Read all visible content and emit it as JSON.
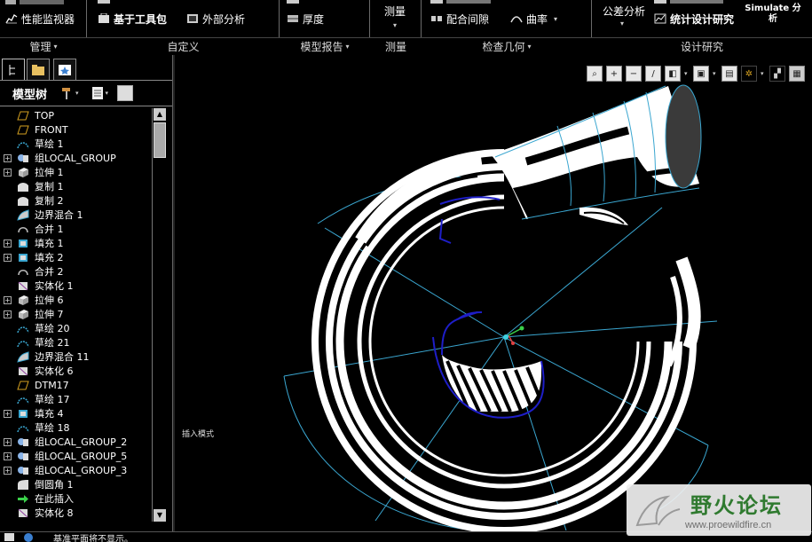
{
  "ribbon": {
    "groups": [
      {
        "label": "管理",
        "has_menu": true,
        "buttons": [
          {
            "label": "性能监视器",
            "icon": "performance-monitor-icon"
          }
        ]
      },
      {
        "label": "自定义",
        "has_menu": false,
        "buttons": [
          {
            "label": "基于工具包",
            "icon": "toolkit-icon"
          },
          {
            "label": "外部分析",
            "icon": "external-analysis-icon"
          }
        ]
      },
      {
        "label": "模型报告",
        "has_menu": true,
        "buttons": [
          {
            "label": "厚度",
            "icon": "thickness-icon"
          }
        ]
      },
      {
        "label": "测量",
        "has_menu": false,
        "buttons": [
          {
            "label": "测量",
            "icon": "measure-icon"
          }
        ]
      },
      {
        "label": "检查几何",
        "has_menu": true,
        "buttons": [
          {
            "label": "配合间隙",
            "icon": "clearance-icon"
          },
          {
            "label": "曲率",
            "icon": "curvature-icon"
          }
        ]
      },
      {
        "label": "设计研究",
        "has_menu": false,
        "buttons": [
          {
            "label": "公差分析",
            "icon": "tolerance-analysis-icon"
          },
          {
            "label": "统计设计研究",
            "icon": "statistical-design-icon"
          },
          {
            "label": "Simulate 分析",
            "icon": "simulate-icon"
          }
        ]
      }
    ]
  },
  "left_panel": {
    "tree_title": "模型树",
    "tree_items": [
      {
        "label": "TOP",
        "icon": "datum-plane-icon",
        "expandable": false
      },
      {
        "label": "FRONT",
        "icon": "datum-plane-icon",
        "expandable": false
      },
      {
        "label": "草绘 1",
        "icon": "sketch-icon",
        "expandable": false
      },
      {
        "label": "组LOCAL_GROUP",
        "icon": "group-icon",
        "expandable": true
      },
      {
        "label": "拉伸 1",
        "icon": "extrude-icon",
        "expandable": true
      },
      {
        "label": "复制 1",
        "icon": "copy-icon",
        "expandable": false
      },
      {
        "label": "复制 2",
        "icon": "copy-icon",
        "expandable": false
      },
      {
        "label": "边界混合 1",
        "icon": "boundary-blend-icon",
        "expandable": false
      },
      {
        "label": "合并 1",
        "icon": "merge-icon",
        "expandable": false
      },
      {
        "label": "填充 1",
        "icon": "fill-icon",
        "expandable": true
      },
      {
        "label": "填充 2",
        "icon": "fill-icon",
        "expandable": true
      },
      {
        "label": "合并 2",
        "icon": "merge-icon",
        "expandable": false
      },
      {
        "label": "实体化 1",
        "icon": "solidify-icon",
        "expandable": false
      },
      {
        "label": "拉伸 6",
        "icon": "extrude-icon",
        "expandable": true
      },
      {
        "label": "拉伸 7",
        "icon": "extrude-icon",
        "expandable": true
      },
      {
        "label": "草绘 20",
        "icon": "sketch-icon",
        "expandable": false
      },
      {
        "label": "草绘 21",
        "icon": "sketch-icon",
        "expandable": false
      },
      {
        "label": "边界混合 11",
        "icon": "boundary-blend-icon",
        "expandable": false
      },
      {
        "label": "实体化 6",
        "icon": "solidify-icon",
        "expandable": false
      },
      {
        "label": "DTM17",
        "icon": "datum-plane-icon",
        "expandable": false
      },
      {
        "label": "草绘 17",
        "icon": "sketch-icon",
        "expandable": false
      },
      {
        "label": "填充 4",
        "icon": "fill-icon",
        "expandable": true
      },
      {
        "label": "草绘 18",
        "icon": "sketch-icon",
        "expandable": false
      },
      {
        "label": "组LOCAL_GROUP_2",
        "icon": "group-icon",
        "expandable": true
      },
      {
        "label": "组LOCAL_GROUP_5",
        "icon": "group-icon",
        "expandable": true
      },
      {
        "label": "组LOCAL_GROUP_3",
        "icon": "group-icon",
        "expandable": true
      },
      {
        "label": "倒圆角 1",
        "icon": "round-icon",
        "expandable": false
      },
      {
        "label": "在此插入",
        "icon": "insert-here-arrow-icon",
        "expandable": false
      },
      {
        "label": "实体化 8",
        "icon": "solidify-icon",
        "expandable": false
      }
    ]
  },
  "graphics": {
    "insert_mode_label": "插入模式"
  },
  "status": {
    "message": "基准平面将不显示。"
  },
  "watermark": {
    "title": "野火论坛",
    "url": "www.proewildfire.cn"
  },
  "colors": {
    "background": "#000000",
    "sketch_blue": "#1e1ec8",
    "datum_cyan": "#3aa6d0",
    "watermark_green": "#2f7a2f"
  }
}
